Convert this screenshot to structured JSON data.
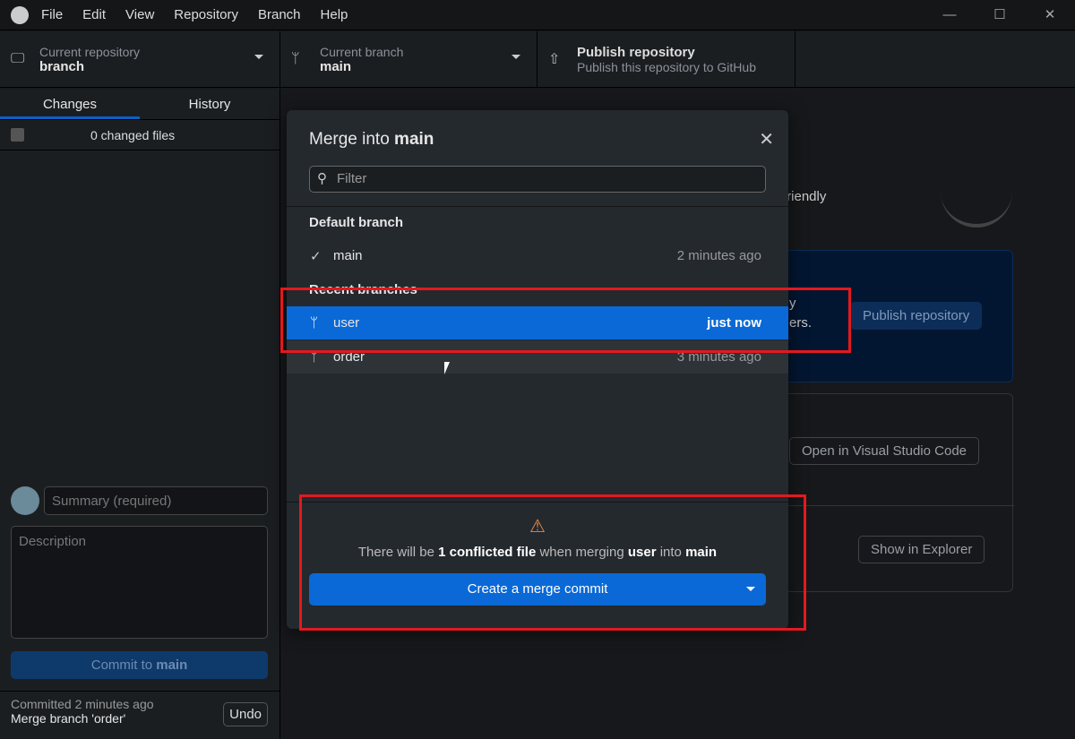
{
  "menu": [
    "File",
    "Edit",
    "View",
    "Repository",
    "Branch",
    "Help"
  ],
  "toolbar": {
    "repo_label": "Current repository",
    "repo_value": "branch",
    "branch_label": "Current branch",
    "branch_value": "main",
    "publish_title": "Publish repository",
    "publish_sub": "Publish this repository to GitHub"
  },
  "sidebar": {
    "tab_changes": "Changes",
    "tab_history": "History",
    "changed_files": "0 changed files",
    "summary_placeholder": "Summary (required)",
    "description_placeholder": "Description",
    "commit_prefix": "Commit to ",
    "commit_branch": "main",
    "last_commit_time": "Committed 2 minutes ago",
    "last_commit_msg": "Merge branch 'order'",
    "undo": "Undo"
  },
  "main": {
    "frag1": "friendly",
    "frag2": "y",
    "frag3": "ers.",
    "publish_btn": "Publish repository",
    "vscode_btn": "Open in Visual Studio Code",
    "explorer_btn": "Show in Explorer"
  },
  "modal": {
    "title_prefix": "Merge into ",
    "title_branch": "main",
    "filter_placeholder": "Filter",
    "default_header": "Default branch",
    "recent_header": "Recent branches",
    "branches": [
      {
        "name": "main",
        "time": "2 minutes ago",
        "icon": "check-icon"
      },
      {
        "name": "user",
        "time": "just now",
        "icon": "branch-icon",
        "selected": true
      },
      {
        "name": "order",
        "time": "3 minutes ago",
        "icon": "branch-icon"
      }
    ],
    "warn_pre": "There will be ",
    "warn_count": "1 conflicted file",
    "warn_mid": " when merging ",
    "warn_from": "user",
    "warn_into": " into ",
    "warn_to": "main",
    "merge_button": "Create a merge commit"
  },
  "colors": {
    "accent": "#0a69d6",
    "highlight": "#e3191e",
    "warning": "#f0883e"
  }
}
